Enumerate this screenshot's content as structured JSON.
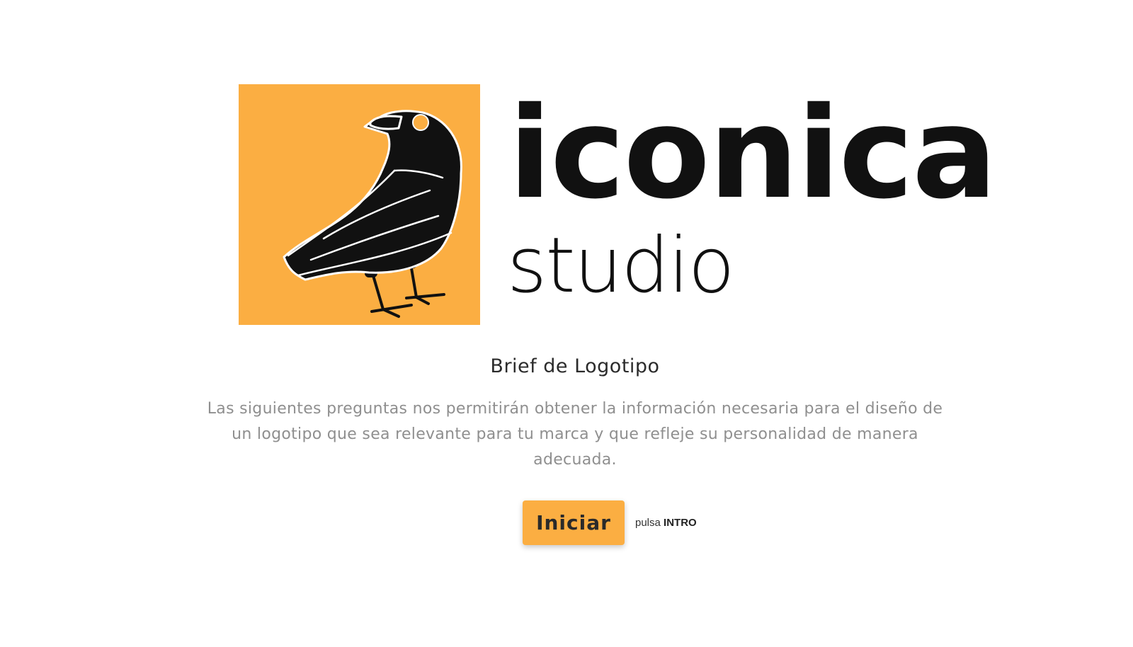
{
  "brand": {
    "name": "iconica",
    "subtitle": "studio",
    "logo_icon": "crow-icon",
    "accent_color": "#fbae42"
  },
  "intro": {
    "title": "Brief de Logotipo",
    "description": "Las siguientes preguntas nos permitirán obtener la información necesaria para el diseño de un logotipo que sea relevante para tu marca y que refleje su personalidad de manera adecuada."
  },
  "cta": {
    "button_label": "Iniciar",
    "hint_prefix": "pulsa",
    "hint_key": "INTRO"
  }
}
